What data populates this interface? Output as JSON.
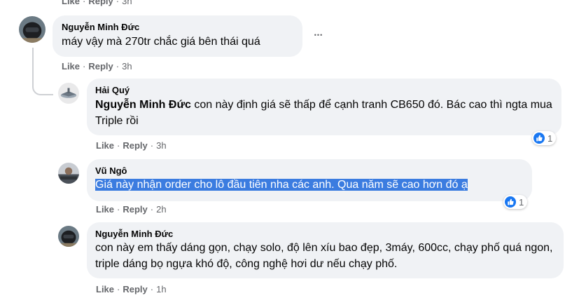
{
  "top_actions": {
    "like": "Like",
    "reply": "Reply",
    "time": "3h"
  },
  "comments": [
    {
      "author": "Nguyễn Minh Đức",
      "text": "máy vậy mà 270tr chắc giá bên thái quá",
      "like": "Like",
      "reply": "Reply",
      "time": "3h"
    },
    {
      "author": "Hải Quý",
      "mention": "Nguyễn Minh Đức",
      "text": " con này định giá sẽ thấp để cạnh tranh CB650 đó. Bác cao thì ngta mua Triple rồi",
      "like": "Like",
      "reply": "Reply",
      "time": "3h",
      "reactions": "1"
    },
    {
      "author": "Vũ Ngô",
      "text": "Giá này nhận order cho lô đầu tiên nha các anh. Qua năm sẽ cao hơn đó ạ",
      "like": "Like",
      "reply": "Reply",
      "time": "2h",
      "reactions": "1"
    },
    {
      "author": "Nguyễn Minh Đức",
      "text": "con này em thấy dáng gọn, chạy solo, độ lên xíu bao đẹp, 3máy, 600cc, chạy phố quá ngon, triple dáng bọ ngựa khó độ, công nghệ hơi dư nếu chạy phố.",
      "like": "Like",
      "reply": "Reply",
      "time": "1h"
    }
  ],
  "separator": "·",
  "more_label": "•••"
}
